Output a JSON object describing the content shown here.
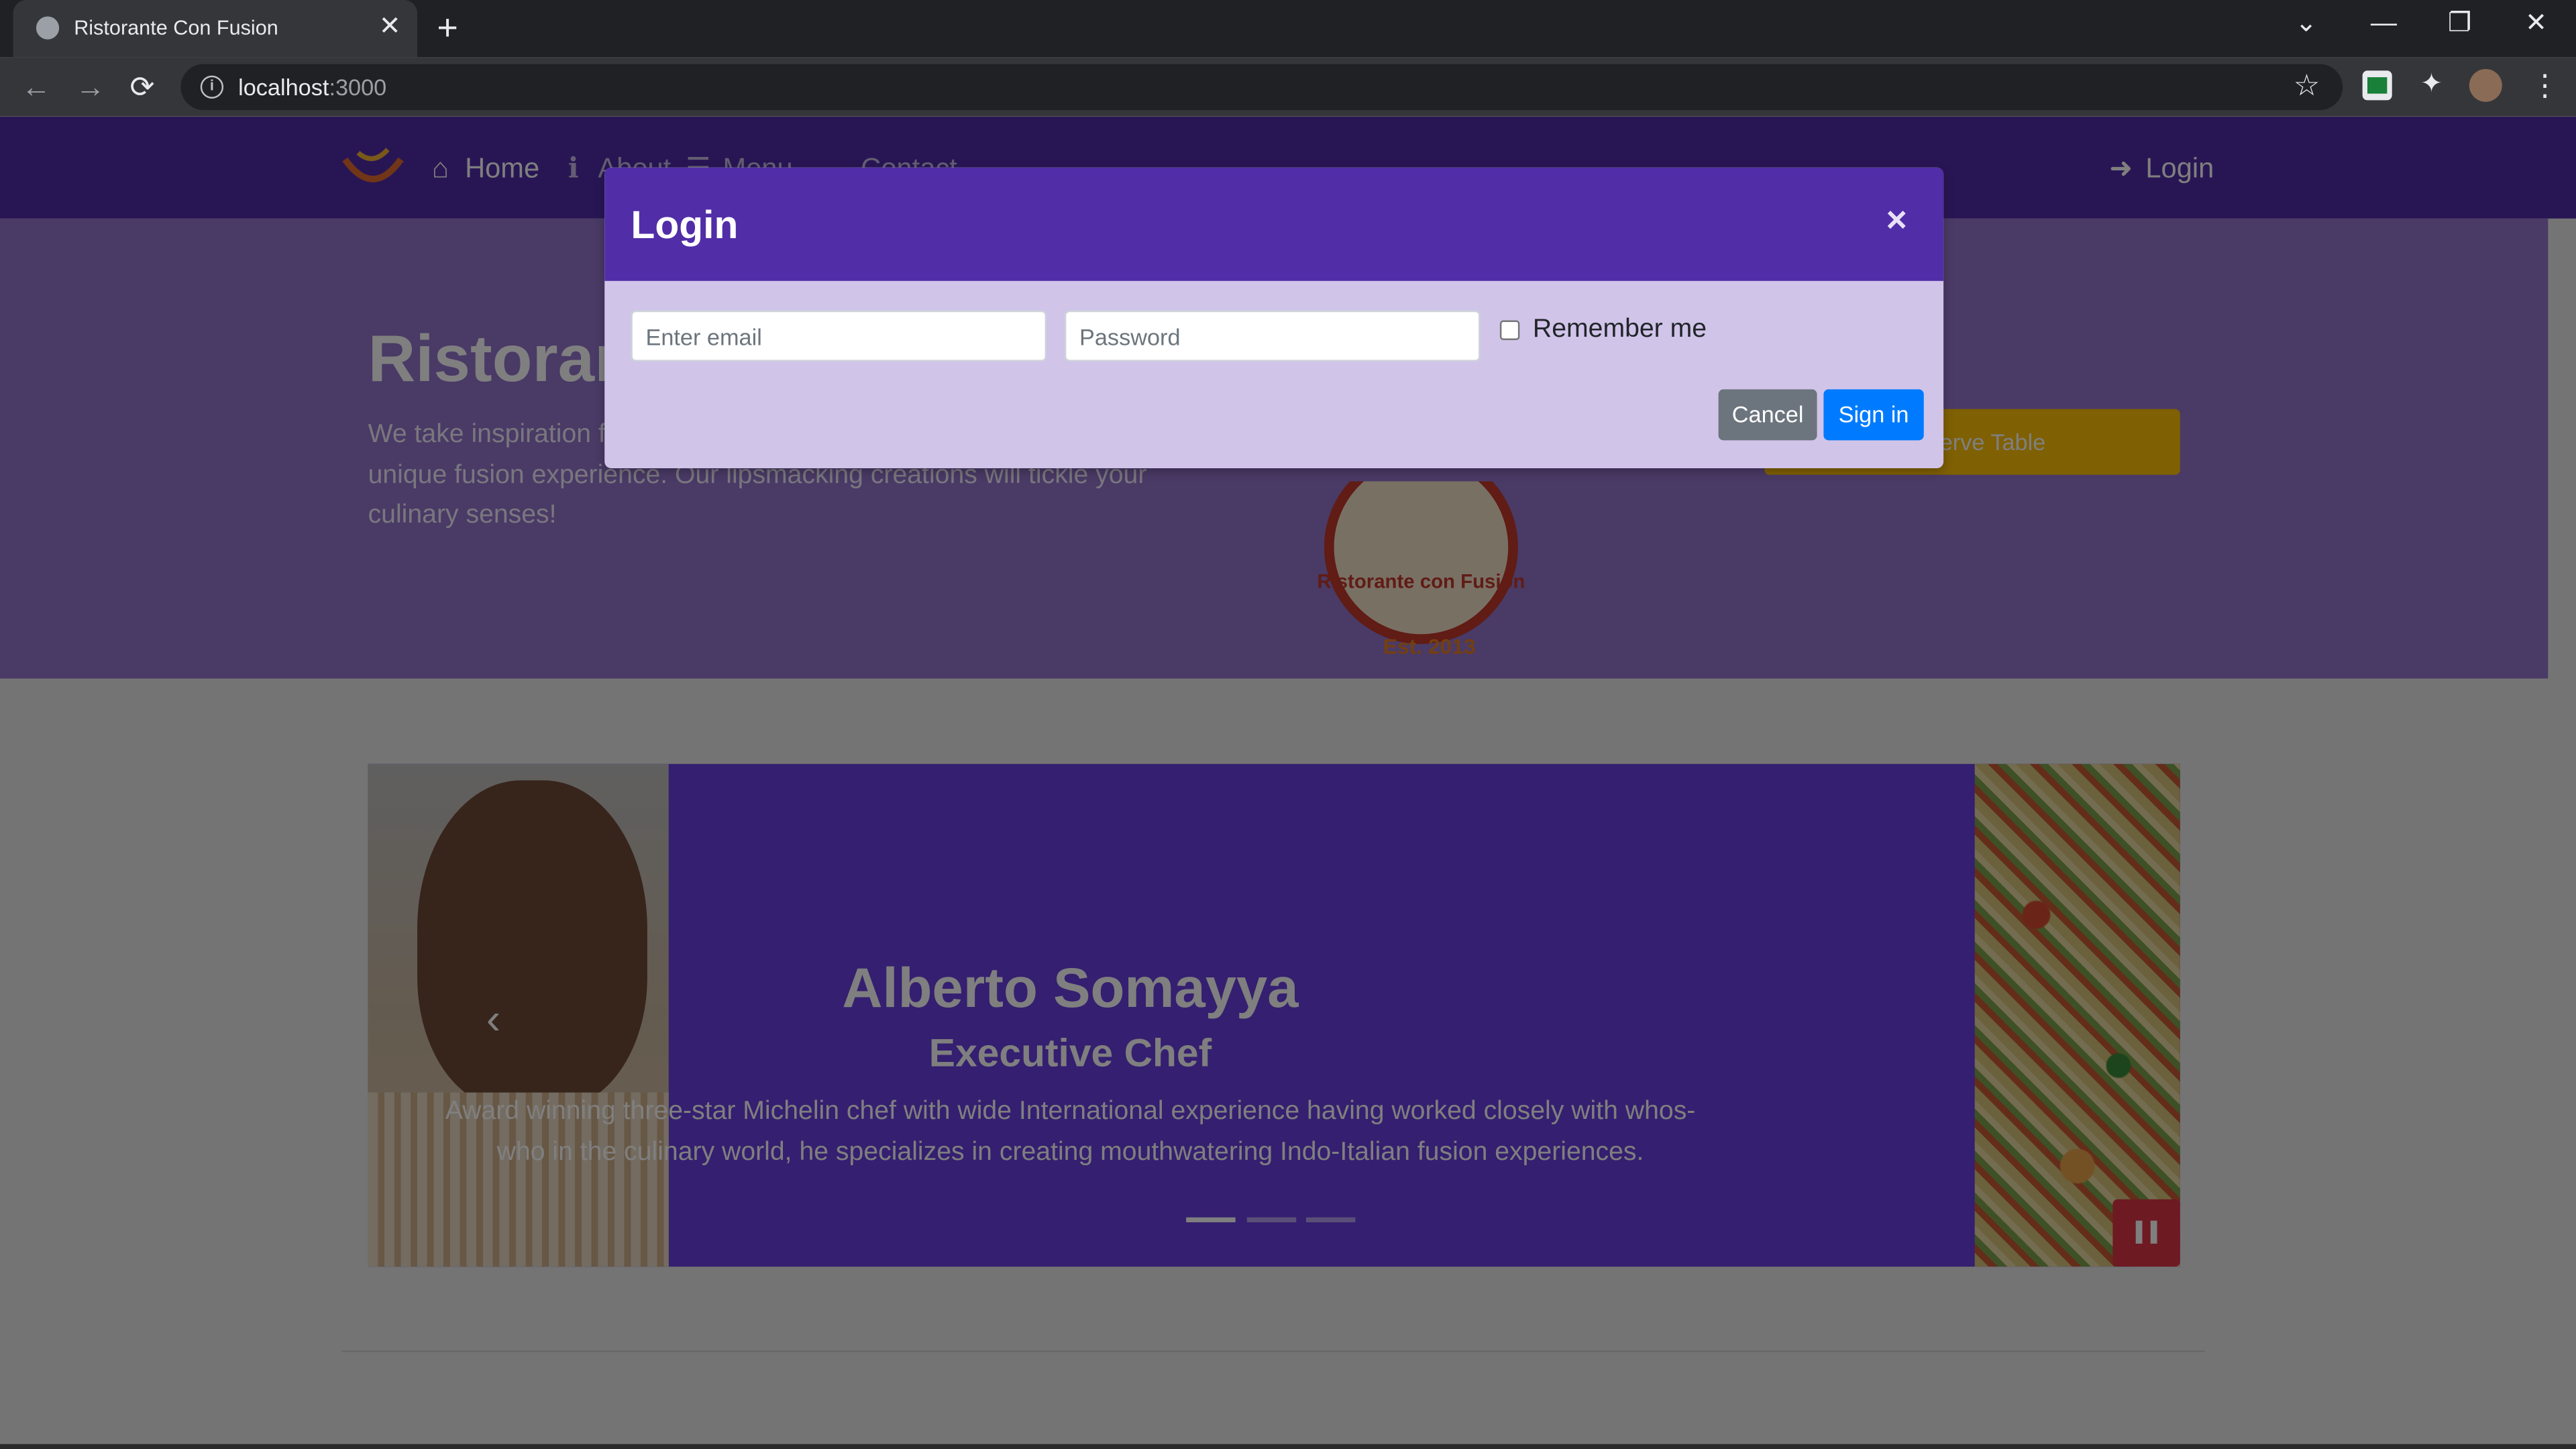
{
  "browser": {
    "tab_title": "Ristorante Con Fusion",
    "tab_close": "✕",
    "new_tab": "+",
    "controls": {
      "tab_search": "⌄",
      "minimize": "—",
      "restore": "❐",
      "close": "✕"
    },
    "nav": {
      "back": "←",
      "forward": "→",
      "reload": "⟳"
    },
    "url_host": "localhost",
    "url_port": ":3000",
    "bookmark": "☆",
    "menu": "⋮"
  },
  "navbar": {
    "items": [
      {
        "label": "Home",
        "icon": "home-icon",
        "glyph": "⌂"
      },
      {
        "label": "About",
        "icon": "info-icon",
        "glyph": "ℹ"
      },
      {
        "label": "Menu",
        "icon": "list-icon",
        "glyph": "☰"
      },
      {
        "label": "Contact",
        "icon": "address-card-icon",
        "glyph": ""
      }
    ],
    "login": {
      "label": "Login",
      "icon": "sign-in-icon",
      "glyph": "➜"
    }
  },
  "jumbotron": {
    "title": "Ristorante con Fusion",
    "text": "We take inspiration from the World's best cuisines, and create a unique fusion experience. Our lipsmacking creations will tickle your culinary senses!",
    "badge_text": "Ristorante con Fusion",
    "badge_est": "Est. 2013",
    "reserve_button": "Reserve Table"
  },
  "carousel": {
    "title": "Alberto Somayya",
    "subtitle": "Executive Chef",
    "description": "Award winning three-star Michelin chef with wide International experience having worked closely with whos-who in the culinary world, he specializes in creating mouthwatering Indo-Italian fusion experiences.",
    "prev_glyph": "‹",
    "indicators": [
      true,
      false,
      false
    ]
  },
  "modal": {
    "title": "Login",
    "close_glyph": "×",
    "email_placeholder": "Enter email",
    "password_placeholder": "Password",
    "remember_label": "Remember me",
    "cancel_button": "Cancel",
    "signin_button": "Sign in"
  },
  "colors": {
    "brand_primary": "#512da8",
    "brand_light": "#9575cd",
    "modal_body": "#d1c4e9",
    "reserve": "#ffc107",
    "signin": "#007bff",
    "cancel": "#6c757d",
    "pause": "#dc3545"
  }
}
